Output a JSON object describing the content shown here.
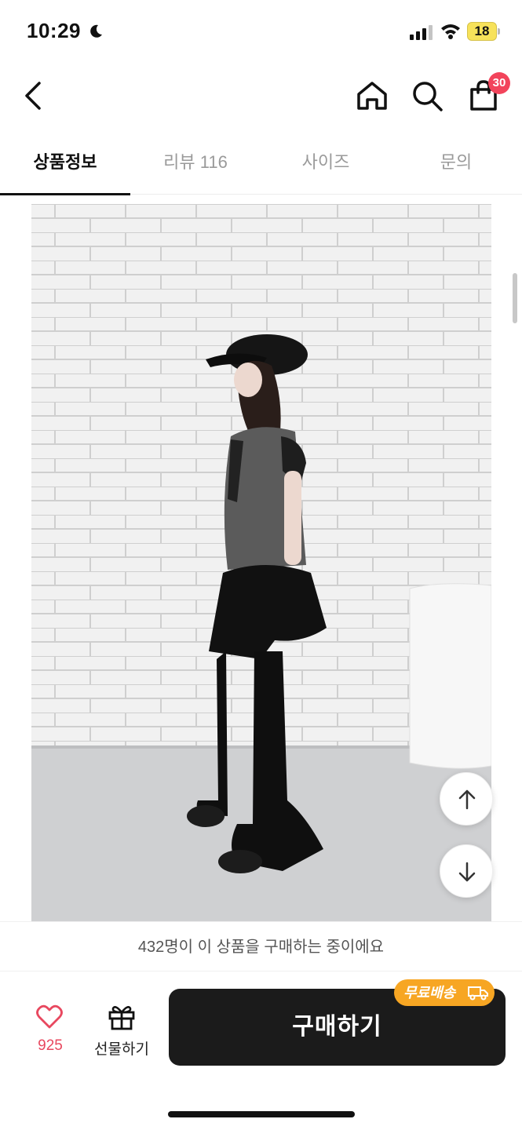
{
  "status_bar": {
    "time": "10:29",
    "battery_level": "18",
    "icons": [
      "moon-icon",
      "signal-icon",
      "wifi-icon",
      "battery-icon"
    ]
  },
  "nav": {
    "icons": [
      "chevron-left-icon",
      "home-icon",
      "search-icon",
      "shopping-bag-icon"
    ],
    "cart_count": "30"
  },
  "tabs": [
    {
      "label": "상품정보",
      "active": true
    },
    {
      "label": "리뷰 116",
      "active": false
    },
    {
      "label": "사이즈",
      "active": false
    },
    {
      "label": "문의",
      "active": false
    }
  ],
  "notice": {
    "text": "432명이 이 상품을 구매하는 중이에요"
  },
  "bottom_bar": {
    "like_count": "925",
    "gift_label": "선물하기",
    "buy_label": "구매하기",
    "free_shipping_label": "무료배송"
  },
  "colors": {
    "accent_red": "#f2445b",
    "like_red": "#e8485f",
    "buy_button": "#1b1b1b",
    "free_shipping": "#f7a623",
    "battery_yellow": "#f7e25a"
  }
}
